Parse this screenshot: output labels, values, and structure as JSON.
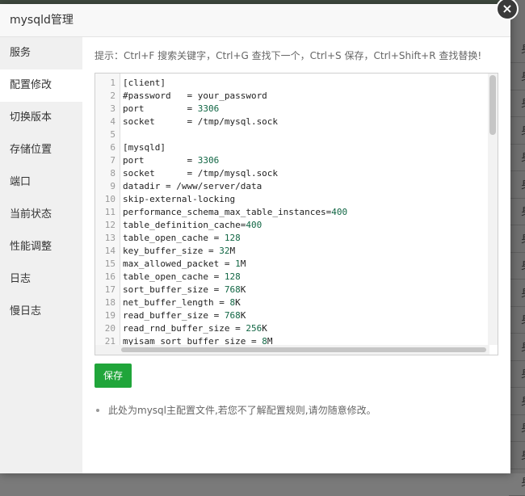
{
  "dialog": {
    "title": "mysqld管理",
    "close_glyph": "×"
  },
  "sidebar": {
    "items": [
      {
        "label": "服务",
        "name": "sidebar-item-service"
      },
      {
        "label": "配置修改",
        "name": "sidebar-item-config",
        "active": true
      },
      {
        "label": "切换版本",
        "name": "sidebar-item-version"
      },
      {
        "label": "存储位置",
        "name": "sidebar-item-storage"
      },
      {
        "label": "端口",
        "name": "sidebar-item-port"
      },
      {
        "label": "当前状态",
        "name": "sidebar-item-status"
      },
      {
        "label": "性能调整",
        "name": "sidebar-item-performance"
      },
      {
        "label": "日志",
        "name": "sidebar-item-log"
      },
      {
        "label": "慢日志",
        "name": "sidebar-item-slowlog"
      }
    ]
  },
  "hint": "提示：Ctrl+F 搜索关键字，Ctrl+G 查找下一个，Ctrl+S 保存，Ctrl+Shift+R 查找替换!",
  "editor": {
    "lines": [
      "[client]",
      "#password   = your_password",
      "port        = 3306",
      "socket      = /tmp/mysql.sock",
      "",
      "[mysqld]",
      "port        = 3306",
      "socket      = /tmp/mysql.sock",
      "datadir = /www/server/data",
      "skip-external-locking",
      "performance_schema_max_table_instances=400",
      "table_definition_cache=400",
      "table_open_cache = 128",
      "key_buffer_size = 32M",
      "max_allowed_packet = 1M",
      "table_open_cache = 128",
      "sort_buffer_size = 768K",
      "net_buffer_length = 8K",
      "read_buffer_size = 768K",
      "read_rnd_buffer_size = 256K",
      "myisam_sort_buffer_size = 8M"
    ]
  },
  "save_label": "保存",
  "notes": [
    "此处为mysql主配置文件,若您不了解配置规则,请勿随意修改。"
  ],
  "background": {
    "row_glyph": "身",
    "row_count": 17
  },
  "colors": {
    "accent": "#20a53a",
    "number_token": "#116644"
  },
  "icons": {
    "close": "close-icon"
  }
}
